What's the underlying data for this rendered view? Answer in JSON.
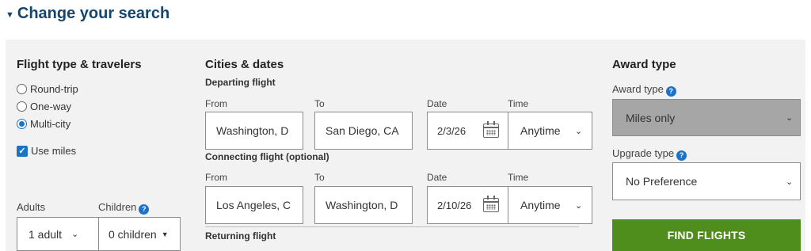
{
  "header": {
    "title": "Change your search"
  },
  "flight_type": {
    "title": "Flight type & travelers",
    "options": [
      {
        "label": "Round-trip",
        "selected": false
      },
      {
        "label": "One-way",
        "selected": false
      },
      {
        "label": "Multi-city",
        "selected": true
      }
    ],
    "use_miles": {
      "label": "Use miles",
      "checked": true
    }
  },
  "travelers": {
    "adults_label": "Adults",
    "children_label": "Children",
    "adults_value": "1 adult",
    "children_value": "0 children"
  },
  "cities": {
    "title": "Cities & dates",
    "departing": {
      "title": "Departing flight",
      "from_label": "From",
      "to_label": "To",
      "date_label": "Date",
      "time_label": "Time",
      "from": "Washington, D",
      "to": "San Diego, CA",
      "date": "2/3/26",
      "time": "Anytime"
    },
    "connecting": {
      "title": "Connecting flight (optional)",
      "from_label": "From",
      "to_label": "To",
      "date_label": "Date",
      "time_label": "Time",
      "from": "Los Angeles, C",
      "to": "Washington, D",
      "date": "2/10/26",
      "time": "Anytime"
    },
    "returning": {
      "title": "Returning flight"
    }
  },
  "award": {
    "title": "Award type",
    "award_type_label": "Award type",
    "award_type_value": "Miles only",
    "upgrade_label": "Upgrade type",
    "upgrade_value": "No Preference",
    "find_button": "FIND FLIGHTS"
  },
  "icons": {
    "collapse": "triangle-down-icon",
    "info": "info-icon",
    "calendar": "calendar-icon",
    "chevron": "chevron-down-icon"
  },
  "colors": {
    "heading": "#15466e",
    "panel_bg": "#f2f2f2",
    "accent": "#1a73c7",
    "disabled_select": "#a6a6a6",
    "find_button": "#4f8e1c"
  }
}
